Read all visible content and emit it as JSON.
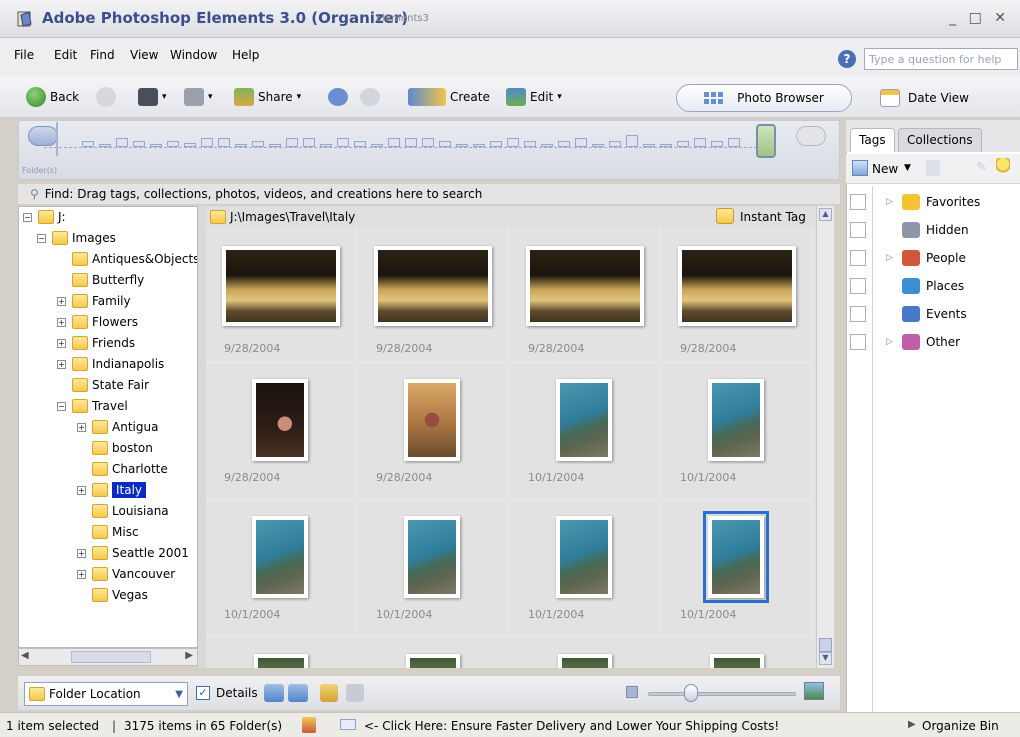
{
  "window": {
    "title": "Adobe Photoshop Elements 3.0 (Organizer)",
    "subtitle": "Elements3",
    "controls": "_ □ ✕"
  },
  "menu": {
    "items": [
      "File",
      "Edit",
      "Find",
      "View",
      "Window",
      "Help"
    ],
    "help_placeholder": "Type a question for help"
  },
  "toolbar": {
    "back": "Back",
    "share": "Share",
    "create": "Create",
    "edit": "Edit",
    "photo_browser": "Photo Browser",
    "date_view": "Date View"
  },
  "timeline": {
    "folders_label": "Folder(s)"
  },
  "find_bar": {
    "text": "Find: Drag tags, collections, photos, videos, and creations here to search"
  },
  "tree": {
    "root": "J:",
    "items": [
      {
        "label": "Images",
        "level": 1,
        "expander": "-"
      },
      {
        "label": "Antiques&Objects",
        "level": 2,
        "expander": ""
      },
      {
        "label": "Butterfly",
        "level": 2,
        "expander": ""
      },
      {
        "label": "Family",
        "level": 2,
        "expander": "+"
      },
      {
        "label": "Flowers",
        "level": 2,
        "expander": "+"
      },
      {
        "label": "Friends",
        "level": 2,
        "expander": "+"
      },
      {
        "label": "Indianapolis",
        "level": 2,
        "expander": "+"
      },
      {
        "label": "State Fair",
        "level": 2,
        "expander": ""
      },
      {
        "label": "Travel",
        "level": 2,
        "expander": "-"
      },
      {
        "label": "Antigua",
        "level": 3,
        "expander": "+"
      },
      {
        "label": "boston",
        "level": 3,
        "expander": ""
      },
      {
        "label": "Charlotte",
        "level": 3,
        "expander": ""
      },
      {
        "label": "Italy",
        "level": 3,
        "expander": "+",
        "selected": true
      },
      {
        "label": "Louisiana",
        "level": 3,
        "expander": ""
      },
      {
        "label": "Misc",
        "level": 3,
        "expander": ""
      },
      {
        "label": "Seattle 2001",
        "level": 3,
        "expander": "+"
      },
      {
        "label": "Vancouver",
        "level": 3,
        "expander": "+"
      },
      {
        "label": "Vegas",
        "level": 3,
        "expander": ""
      }
    ]
  },
  "grid": {
    "path": "J:\\Images\\Travel\\Italy",
    "instant_tag": "Instant Tag",
    "photos": [
      {
        "date": "9/28/2004",
        "kind": "monument",
        "orientation": "landscape"
      },
      {
        "date": "9/28/2004",
        "kind": "monument",
        "orientation": "landscape"
      },
      {
        "date": "9/28/2004",
        "kind": "monument",
        "orientation": "landscape"
      },
      {
        "date": "9/28/2004",
        "kind": "monument",
        "orientation": "landscape"
      },
      {
        "date": "9/28/2004",
        "kind": "night-person",
        "orientation": "portrait"
      },
      {
        "date": "9/28/2004",
        "kind": "day-person",
        "orientation": "portrait"
      },
      {
        "date": "10/1/2004",
        "kind": "sea",
        "orientation": "portrait"
      },
      {
        "date": "10/1/2004",
        "kind": "sea",
        "orientation": "portrait"
      },
      {
        "date": "10/1/2004",
        "kind": "sea",
        "orientation": "portrait"
      },
      {
        "date": "10/1/2004",
        "kind": "sea",
        "orientation": "portrait"
      },
      {
        "date": "10/1/2004",
        "kind": "sea",
        "orientation": "portrait"
      },
      {
        "date": "10/1/2004",
        "kind": "sea",
        "orientation": "portrait",
        "selected": true
      }
    ]
  },
  "grid_bottom": {
    "folder_location": "Folder Location",
    "details": "Details"
  },
  "right_pane": {
    "tabs": [
      "Tags",
      "Collections"
    ],
    "new_label": "New",
    "tags": [
      {
        "label": "Favorites",
        "icon": "star-icon",
        "color": "#f2c230",
        "expandable": true
      },
      {
        "label": "Hidden",
        "icon": "hidden-icon",
        "color": "#8d96a8",
        "expandable": false
      },
      {
        "label": "People",
        "icon": "people-icon",
        "color": "#d2563a",
        "expandable": true
      },
      {
        "label": "Places",
        "icon": "globe-icon",
        "color": "#3a8fd2",
        "expandable": false
      },
      {
        "label": "Events",
        "icon": "events-icon",
        "color": "#4a78c8",
        "expandable": false
      },
      {
        "label": "Other",
        "icon": "other-icon",
        "color": "#c25ea8",
        "expandable": true
      }
    ]
  },
  "status": {
    "selection": "1 item selected",
    "summary": "3175 items in 65 Folder(s)",
    "promo": "<- Click Here: Ensure Faster Delivery and Lower Your Shipping Costs!",
    "organize_bin": "Organize Bin"
  }
}
